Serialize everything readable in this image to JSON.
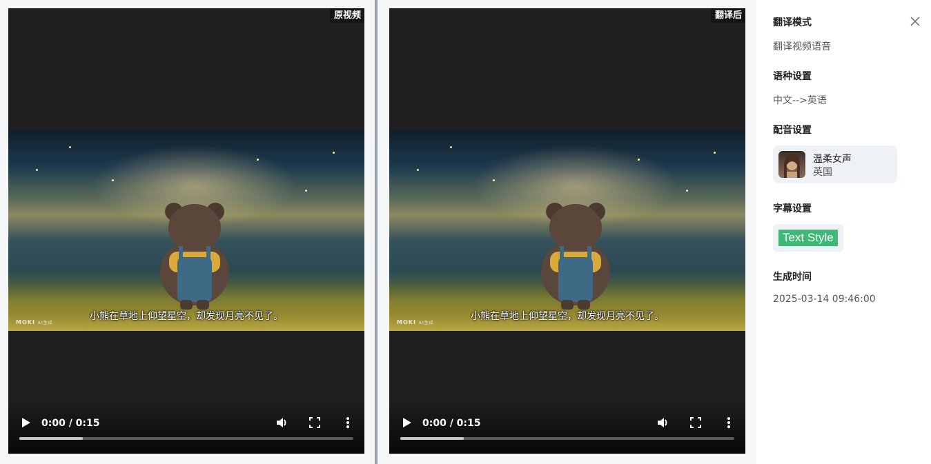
{
  "videos": [
    {
      "tag": "原视频",
      "subtitle": "小熊在草地上仰望星空，却发现月亮不见了。",
      "logo": "MOKI",
      "logo_sub": "AI生成",
      "time": "0:00 / 0:15",
      "progress": 0.19
    },
    {
      "tag": "翻译后",
      "subtitle": "小熊在草地上仰望星空，却发现月亮不见了。",
      "logo": "MOKI",
      "logo_sub": "AI生成",
      "time": "0:00 / 0:15",
      "progress": 0.19
    }
  ],
  "icons": {
    "play": "play-icon",
    "volume": "volume-icon",
    "fullscreen": "fullscreen-icon",
    "more": "more-vertical-icon",
    "close": "close-icon"
  },
  "side": {
    "mode_title": "翻译模式",
    "mode_value": "翻译视频语音",
    "lang_title": "语种设置",
    "lang_value": "中文-->英语",
    "voice_title": "配音设置",
    "voice_name": "温柔女声",
    "voice_region": "英国",
    "subtitle_title": "字幕设置",
    "subtitle_style": "Text Style",
    "time_title": "生成时间",
    "time_value": "2025-03-14 09:46:00"
  },
  "colors": {
    "accent_chip": "#3fb877",
    "card_bg": "#eef1f6",
    "video_bg": "#1f1f1f"
  }
}
